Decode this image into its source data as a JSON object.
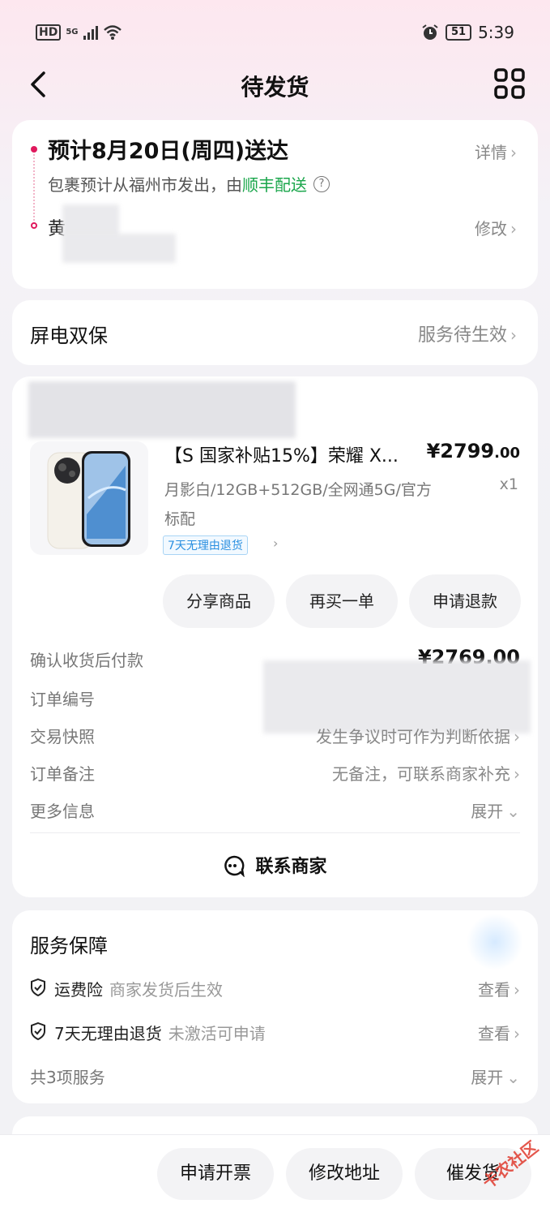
{
  "status_bar": {
    "hd": "HD",
    "network": "5G",
    "battery": "51",
    "time": "5:39"
  },
  "header": {
    "title": "待发货",
    "grid_icon": "grid-icon",
    "back_icon": "back-icon"
  },
  "delivery": {
    "eta": "预计8月20日(周四)送达",
    "detail": "详情",
    "ship_prefix": "包裹预计从福州市发出，由",
    "carrier": "顺丰配送",
    "help": "?",
    "recipient_initial": "黄",
    "edit": "修改"
  },
  "protection": {
    "title": "屏电双保",
    "status": "服务待生效"
  },
  "order": {
    "product_name": "【S 国家补贴15%】荣耀 X...",
    "price_main": "¥2799",
    "price_dec": ".00",
    "spec": "月影白/12GB+512GB/全网通5G/官方标配",
    "qty": "x1",
    "return_tag": "7天无理由退货",
    "buttons": [
      "分享商品",
      "再买一单",
      "申请退款"
    ],
    "rows": [
      {
        "label": "确认收货后付款",
        "value": "¥2769.00"
      },
      {
        "label": "订单编号",
        "value": ""
      },
      {
        "label": "交易快照",
        "value": "发生争议时可作为判断依据"
      },
      {
        "label": "订单备注",
        "value": "无备注，可联系商家补充"
      },
      {
        "label": "更多信息",
        "value": "展开"
      }
    ],
    "contact": "联系商家"
  },
  "service": {
    "title": "服务保障",
    "items": [
      {
        "name": "运费险",
        "desc": "商家发货后生效",
        "action": "查看"
      },
      {
        "name": "7天无理由退货",
        "desc": "未激活可申请",
        "action": "查看"
      }
    ],
    "total": "共3项服务",
    "expand": "展开"
  },
  "bottom": {
    "buttons": [
      "申请开票",
      "修改地址",
      "催发货"
    ]
  },
  "watermark": "卡农社区",
  "colors": {
    "accent": "#e0195d",
    "carrier_green": "#1aa64b",
    "tag_blue": "#2a8fe0"
  }
}
